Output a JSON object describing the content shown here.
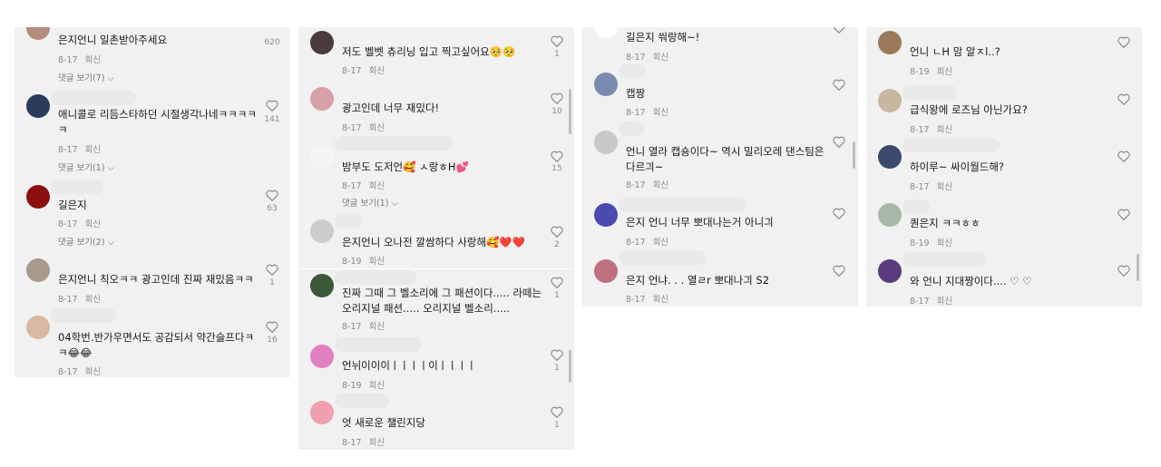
{
  "panels": [
    {
      "comments": [
        {
          "text": "은지언니 일촌받아주세요",
          "date": "8-17",
          "reply": "회신",
          "likes": "620",
          "replies": "댓글 보기(7)",
          "avatar": "#b38d7e"
        },
        {
          "text": "애니콜로 리듬스타하던 시절생각나네ㅋㅋㅋㅋㅋ",
          "date": "8-17",
          "reply": "회신",
          "likes": "141",
          "replies": "댓글 보기(1)",
          "avatar": "#2a3c5a"
        },
        {
          "text": "길은지",
          "date": "8-17",
          "reply": "회신",
          "likes": "63",
          "replies": "댓글 보기(2)",
          "avatar": "#8c1010"
        },
        {
          "text": "은지언니 칙오ㅋㅋ 광고인데 진짜 재밌음ㅋㅋ",
          "date": "8-17",
          "reply": "회신",
          "likes": "1",
          "avatar": "#a89a8a"
        },
        {
          "text": "04학번.반가우면서도 공감되서 약간슬프다ㅋㅋ😂😂",
          "date": "8-17",
          "reply": "회신",
          "likes": "16",
          "avatar": "#d9b8a0"
        }
      ]
    },
    {
      "comments": [
        {
          "text": "저도 벨벳 츄리닝 입고 찍고싶어요🥺🥺",
          "date": "8-17",
          "reply": "회신",
          "likes": "1",
          "avatar": "#4a3a3a"
        },
        {
          "text": "광고인데 너무 재밌다!",
          "date": "8-17",
          "reply": "회신",
          "likes": "10",
          "avatar": "#d8a0a8"
        },
        {
          "text": "밤부도 도저언🥰 ㅅ랑ㅎH💕",
          "date": "8-17",
          "reply": "회신",
          "likes": "15",
          "replies": "댓글 보기(1)",
          "avatar": "#f5f5f5"
        },
        {
          "text": "은지언니 오나전 깔쌈하다 사랑해🥰❤️❤️",
          "date": "8-19",
          "reply": "회신",
          "likes": "2",
          "avatar": "#cccccc"
        },
        {
          "text": "진짜 그때 그 벨소리에 그 패션이다..... 라떼는 오리지널 패션..... 오리지널 벨소리.....",
          "date": "8-17",
          "reply": "회신",
          "likes": "1",
          "avatar": "#3a5a3a"
        },
        {
          "text": "언뉘이이이ㅣㅣㅣㅣ이ㅣㅣㅣㅣ",
          "date": "8-19",
          "reply": "회신",
          "likes": "1",
          "avatar": "#e080c0"
        },
        {
          "text": "엇 새로운 챌린지당",
          "date": "8-17",
          "reply": "회신",
          "likes": "1",
          "avatar": "#f0a0b0"
        }
      ]
    },
    {
      "comments": [
        {
          "text": "길은지 쒀랑해~!",
          "date": "8-17",
          "reply": "회신",
          "avatar": "#ffffff"
        },
        {
          "text": "캡짱",
          "date": "8-17",
          "reply": "회신",
          "avatar": "#7a8ab0"
        },
        {
          "text": "언니 열라 캡숑이다~ 역시 밀리오레 댄스팀은 다르긔~",
          "date": "8-17",
          "reply": "회신",
          "avatar": "#c8c8c8"
        },
        {
          "text": "은지 언니 너무 뽀대나는거 아니긔",
          "date": "8-17",
          "reply": "회신",
          "avatar": "#4a4ab0"
        },
        {
          "text": "은지 언냐. . . 열ㄹr 뽀대나긔 S2",
          "date": "8-17",
          "reply": "회신",
          "avatar": "#c07080"
        }
      ]
    },
    {
      "comments": [
        {
          "text": "언니 ㄴH 맘 알ㅈl..?",
          "date": "8-19",
          "reply": "회신",
          "avatar": "#9a7a5a"
        },
        {
          "text": "급식왕에 로즈님 아닌가요?",
          "date": "8-17",
          "reply": "회신",
          "avatar": "#c8b8a0"
        },
        {
          "text": "하이루~ 싸이월드해?",
          "date": "8-17",
          "reply": "회신",
          "avatar": "#3a4a6a"
        },
        {
          "text": "퀀은지 ㅋㅋㅎㅎ",
          "date": "8-19",
          "reply": "회신",
          "avatar": "#a8b8a8"
        },
        {
          "text": "와 언니 지대짱이다.... ♡ ♡",
          "date": "8-17",
          "reply": "회신",
          "avatar": "#5a3a7a"
        }
      ]
    }
  ]
}
